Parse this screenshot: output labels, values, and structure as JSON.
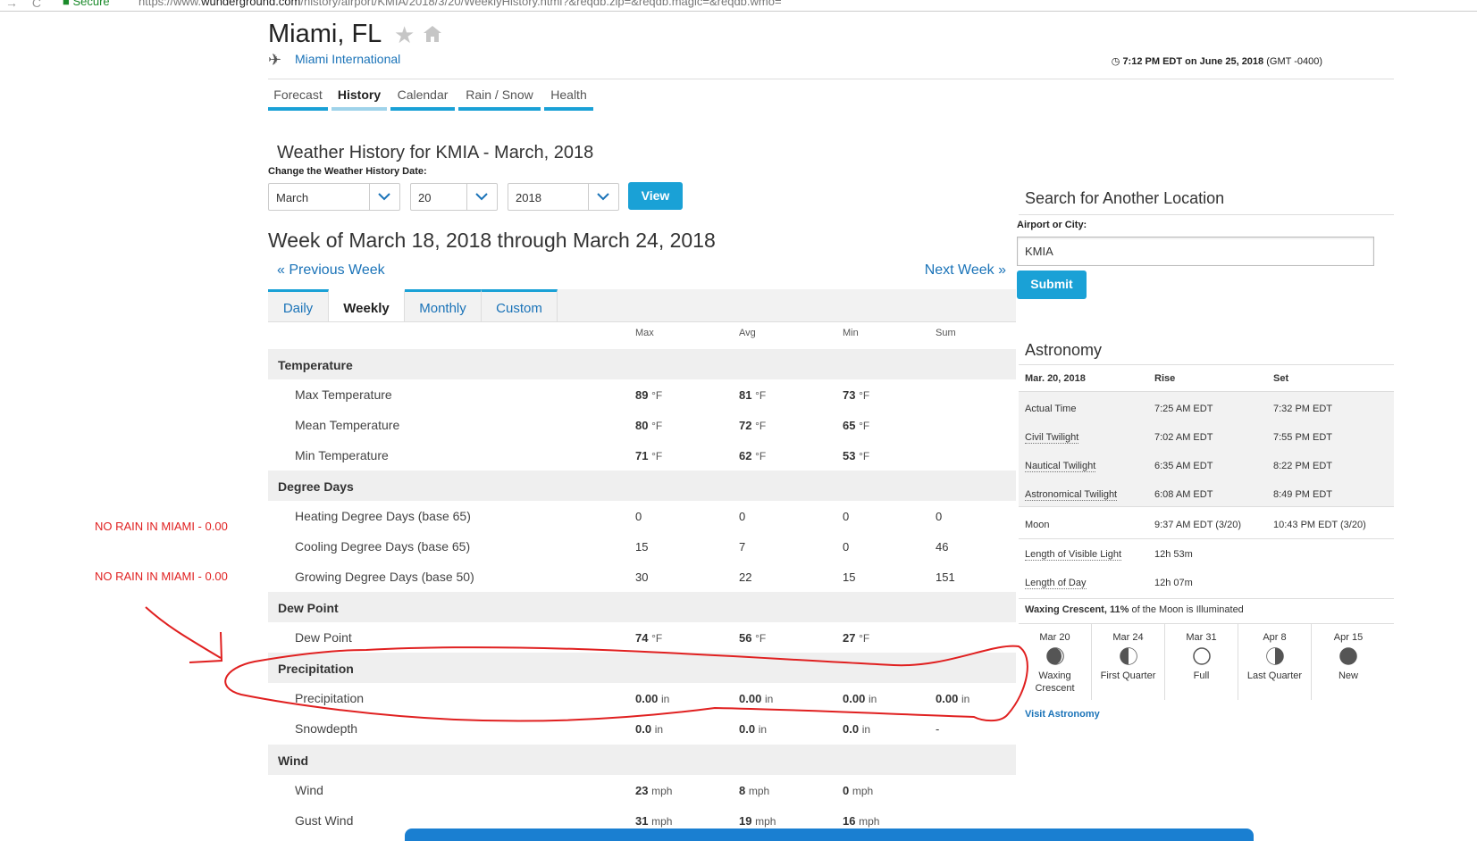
{
  "browser": {
    "secure_label": "Secure",
    "url_prefix": "https://www.",
    "url_domain": "wunderground.com",
    "url_path": "/history/airport/KMIA/2018/3/20/WeeklyHistory.html?&reqdb.zip=&reqdb.magic=&reqdb.wmo="
  },
  "header": {
    "city": "Miami, FL",
    "airport": "Miami International",
    "local_time": "7:12 PM EDT on June 25, 2018",
    "gmt": "(GMT -0400)"
  },
  "tabs": [
    {
      "label": "Forecast"
    },
    {
      "label": "History"
    },
    {
      "label": "Calendar"
    },
    {
      "label": "Rain / Snow"
    },
    {
      "label": "Health"
    }
  ],
  "history": {
    "title": "Weather History for KMIA - March, 2018",
    "change_label": "Change the Weather History Date:",
    "month": "March",
    "day": "20",
    "year": "2018",
    "view_label": "View",
    "week_title": "Week of March 18, 2018 through March 24, 2018",
    "prev_week": "« Previous Week",
    "next_week": "Next Week »"
  },
  "subtabs": [
    {
      "label": "Daily"
    },
    {
      "label": "Weekly"
    },
    {
      "label": "Monthly"
    },
    {
      "label": "Custom"
    }
  ],
  "table": {
    "columns": [
      "Max",
      "Avg",
      "Min",
      "Sum"
    ],
    "sections": [
      {
        "title": "Temperature",
        "rows": [
          {
            "label": "Max Temperature",
            "max": "89",
            "avg": "81",
            "min": "73",
            "sum": "",
            "unit": "°F"
          },
          {
            "label": "Mean Temperature",
            "max": "80",
            "avg": "72",
            "min": "65",
            "sum": "",
            "unit": "°F"
          },
          {
            "label": "Min Temperature",
            "max": "71",
            "avg": "62",
            "min": "53",
            "sum": "",
            "unit": "°F"
          }
        ]
      },
      {
        "title": "Degree Days",
        "rows": [
          {
            "label": "Heating Degree Days (base 65)",
            "max": "0",
            "avg": "0",
            "min": "0",
            "sum": "0",
            "unit": ""
          },
          {
            "label": "Cooling Degree Days (base 65)",
            "max": "15",
            "avg": "7",
            "min": "0",
            "sum": "46",
            "unit": ""
          },
          {
            "label": "Growing Degree Days (base 50)",
            "max": "30",
            "avg": "22",
            "min": "15",
            "sum": "151",
            "unit": ""
          }
        ]
      },
      {
        "title": "Dew Point",
        "rows": [
          {
            "label": "Dew Point",
            "max": "74",
            "avg": "56",
            "min": "27",
            "sum": "",
            "unit": "°F"
          }
        ]
      },
      {
        "title": "Precipitation",
        "rows": [
          {
            "label": "Precipitation",
            "max": "0.00",
            "avg": "0.00",
            "min": "0.00",
            "sum": "0.00",
            "unit": "in"
          },
          {
            "label": "Snowdepth",
            "max": "0.0",
            "avg": "0.0",
            "min": "0.0",
            "sum": "-",
            "unit": "in"
          }
        ]
      },
      {
        "title": "Wind",
        "rows": [
          {
            "label": "Wind",
            "max": "23",
            "avg": "8",
            "min": "0",
            "sum": "",
            "unit": "mph"
          },
          {
            "label": "Gust Wind",
            "max": "31",
            "avg": "19",
            "min": "16",
            "sum": "",
            "unit": "mph"
          }
        ]
      }
    ]
  },
  "annotations": {
    "note1": "NO RAIN IN MIAMI - 0.00",
    "note2": "NO RAIN IN MIAMI - 0.00",
    "color": "#e02020"
  },
  "search": {
    "title": "Search for Another Location",
    "label": "Airport or City:",
    "value": "KMIA",
    "submit_label": "Submit"
  },
  "astronomy": {
    "title": "Astronomy",
    "date": "Mar. 20, 2018",
    "rise_label": "Rise",
    "set_label": "Set",
    "rows": [
      {
        "label": "Actual Time",
        "rise": "7:25 AM EDT",
        "set": "7:32 PM EDT"
      },
      {
        "label": "Civil Twilight",
        "rise": "7:02 AM EDT",
        "set": "7:55 PM EDT"
      },
      {
        "label": "Nautical Twilight",
        "rise": "6:35 AM EDT",
        "set": "8:22 PM EDT"
      },
      {
        "label": "Astronomical Twilight",
        "rise": "6:08 AM EDT",
        "set": "8:49 PM EDT"
      }
    ],
    "moon": {
      "label": "Moon",
      "rise": "9:37 AM EDT (3/20)",
      "set": "10:43 PM EDT (3/20)"
    },
    "visible_light": {
      "label": "Length of Visible Light",
      "value": "12h 53m"
    },
    "day_length": {
      "label": "Length of Day",
      "value": "12h 07m"
    },
    "waxing_phase": "Waxing Crescent,",
    "waxing_pct": "11%",
    "waxing_rest": "of the Moon is Illuminated",
    "phases": [
      {
        "date": "Mar 20",
        "name": "Waxing Crescent"
      },
      {
        "date": "Mar 24",
        "name": "First Quarter"
      },
      {
        "date": "Mar 31",
        "name": "Full"
      },
      {
        "date": "Apr 8",
        "name": "Last Quarter"
      },
      {
        "date": "Apr 15",
        "name": "New"
      }
    ],
    "visit_label": "Visit Astronomy"
  },
  "colors": {
    "accent": "#1aa1d6",
    "link": "#1a73b8",
    "annotation": "#e02020"
  }
}
